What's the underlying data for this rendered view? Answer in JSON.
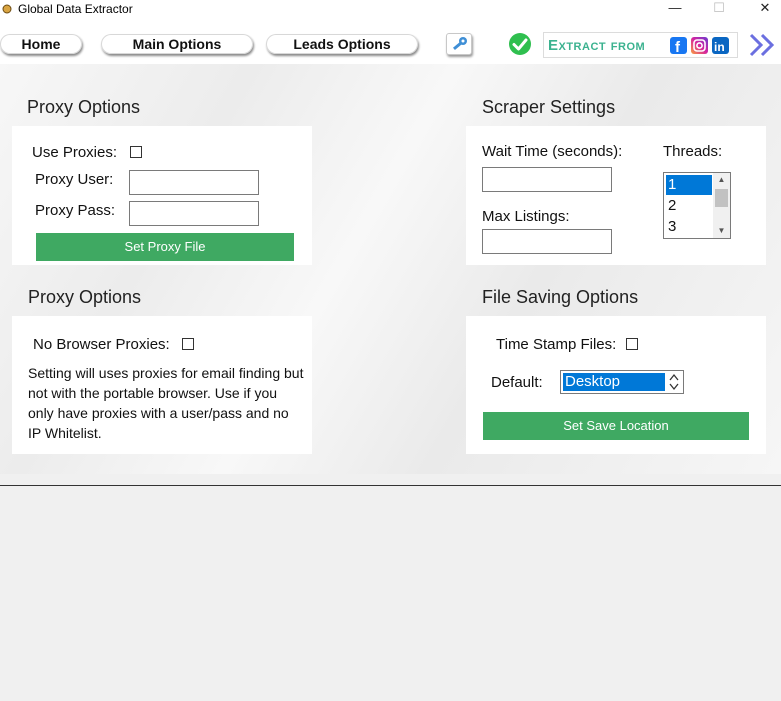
{
  "window": {
    "title": "Global Data Extractor",
    "minimize_glyph": "—",
    "maximize_glyph": "☐",
    "close_glyph": "✕"
  },
  "toolbar": {
    "home_label": "Home",
    "main_options_label": "Main Options",
    "leads_options_label": "Leads Options",
    "key_icon": "key-icon",
    "status_icon": "check-circle-icon",
    "extract_banner_text": "Extract from",
    "social_icons": [
      "facebook-icon",
      "instagram-icon",
      "linkedin-icon"
    ],
    "next_icon": "double-chevron-right-icon"
  },
  "proxy_options": {
    "heading": "Proxy Options",
    "use_proxies_label": "Use Proxies:",
    "use_proxies_checked": false,
    "proxy_user_label": "Proxy User:",
    "proxy_user_value": "",
    "proxy_pass_label": "Proxy Pass:",
    "proxy_pass_value": "",
    "set_proxy_file_label": "Set Proxy File"
  },
  "browser_proxy_options": {
    "heading": "Proxy Options",
    "no_browser_proxies_label": "No Browser Proxies:",
    "no_browser_proxies_checked": false,
    "note": "Setting will uses proxies for email finding but not with the portable browser. Use if you only have proxies with a user/pass and no IP Whitelist."
  },
  "scraper_settings": {
    "heading": "Scraper Settings",
    "wait_time_label": "Wait Time (seconds):",
    "wait_time_value": "",
    "max_listings_label": "Max Listings:",
    "max_listings_value": "",
    "threads_label": "Threads:",
    "threads_options": [
      "1",
      "2",
      "3"
    ],
    "threads_selected": "1"
  },
  "file_saving_options": {
    "heading": "File Saving Options",
    "time_stamp_label": "Time Stamp Files:",
    "time_stamp_checked": false,
    "default_label": "Default:",
    "default_value": "Desktop",
    "set_save_location_label": "Set Save Location"
  },
  "colors": {
    "accent_green": "#3fa962",
    "selection_blue": "#0078d7",
    "banner_teal": "#3bb28f",
    "status_green": "#2fbf4f",
    "chevron_purple": "#6b6fe0"
  }
}
